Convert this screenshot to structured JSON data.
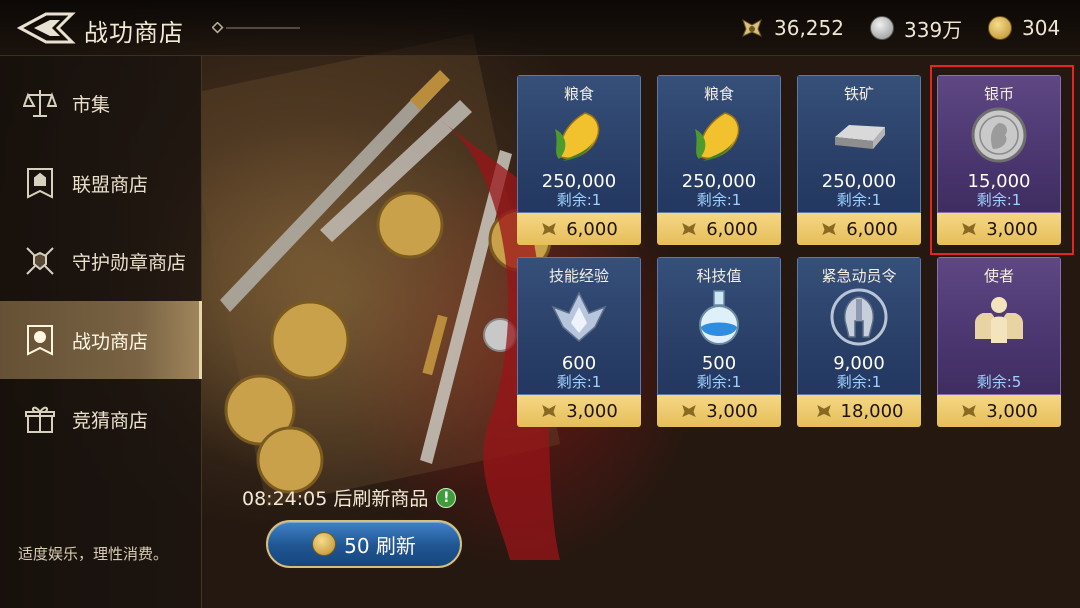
{
  "header": {
    "title": "战功商店",
    "resources": [
      {
        "icon": "merit-medal-icon",
        "value": "36,252"
      },
      {
        "icon": "silver-coin-icon",
        "value": "339万"
      },
      {
        "icon": "gold-coin-icon",
        "value": "304"
      }
    ]
  },
  "sidebar": {
    "items": [
      {
        "label": "市集",
        "icon": "scales-icon",
        "active": false
      },
      {
        "label": "联盟商店",
        "icon": "alliance-banner-icon",
        "active": false
      },
      {
        "label": "守护勋章商店",
        "icon": "crossed-swords-shield-icon",
        "active": false
      },
      {
        "label": "战功商店",
        "icon": "lion-banner-icon",
        "active": true
      },
      {
        "label": "竞猜商店",
        "icon": "gift-box-icon",
        "active": false
      }
    ],
    "notice": "适度娱乐，理性消费。"
  },
  "refresh": {
    "timer_text": "08:24:05 后刷新商品",
    "button_label": "50 刷新"
  },
  "shop": {
    "items": [
      {
        "name": "粮食",
        "icon": "corn-icon",
        "quantity": "250,000",
        "remaining": "剩余:1",
        "price": "6,000",
        "theme": "blue"
      },
      {
        "name": "粮食",
        "icon": "corn-icon",
        "quantity": "250,000",
        "remaining": "剩余:1",
        "price": "6,000",
        "theme": "blue"
      },
      {
        "name": "铁矿",
        "icon": "iron-ingot-icon",
        "quantity": "250,000",
        "remaining": "剩余:1",
        "price": "6,000",
        "theme": "blue"
      },
      {
        "name": "银币",
        "icon": "silver-coin-icon",
        "quantity": "15,000",
        "remaining": "剩余:1",
        "price": "3,000",
        "theme": "purple"
      },
      {
        "name": "技能经验",
        "icon": "skill-crystal-icon",
        "quantity": "600",
        "remaining": "剩余:1",
        "price": "3,000",
        "theme": "blue"
      },
      {
        "name": "科技值",
        "icon": "potion-flask-icon",
        "quantity": "500",
        "remaining": "剩余:1",
        "price": "3,000",
        "theme": "blue"
      },
      {
        "name": "紧急动员令",
        "icon": "spartan-helmet-icon",
        "quantity": "9,000",
        "remaining": "剩余:1",
        "price": "18,000",
        "theme": "blue"
      },
      {
        "name": "使者",
        "icon": "envoy-icon",
        "quantity": "",
        "remaining": "剩余:5",
        "price": "3,000",
        "theme": "purple"
      }
    ]
  },
  "colors": {
    "card_blue": "#2a4068",
    "card_purple": "#4b3670",
    "price_bar": "#e6be5a",
    "remaining_text": "#9fd0ff",
    "highlight_border": "#e3261f",
    "refresh_button": "#1f5592"
  }
}
